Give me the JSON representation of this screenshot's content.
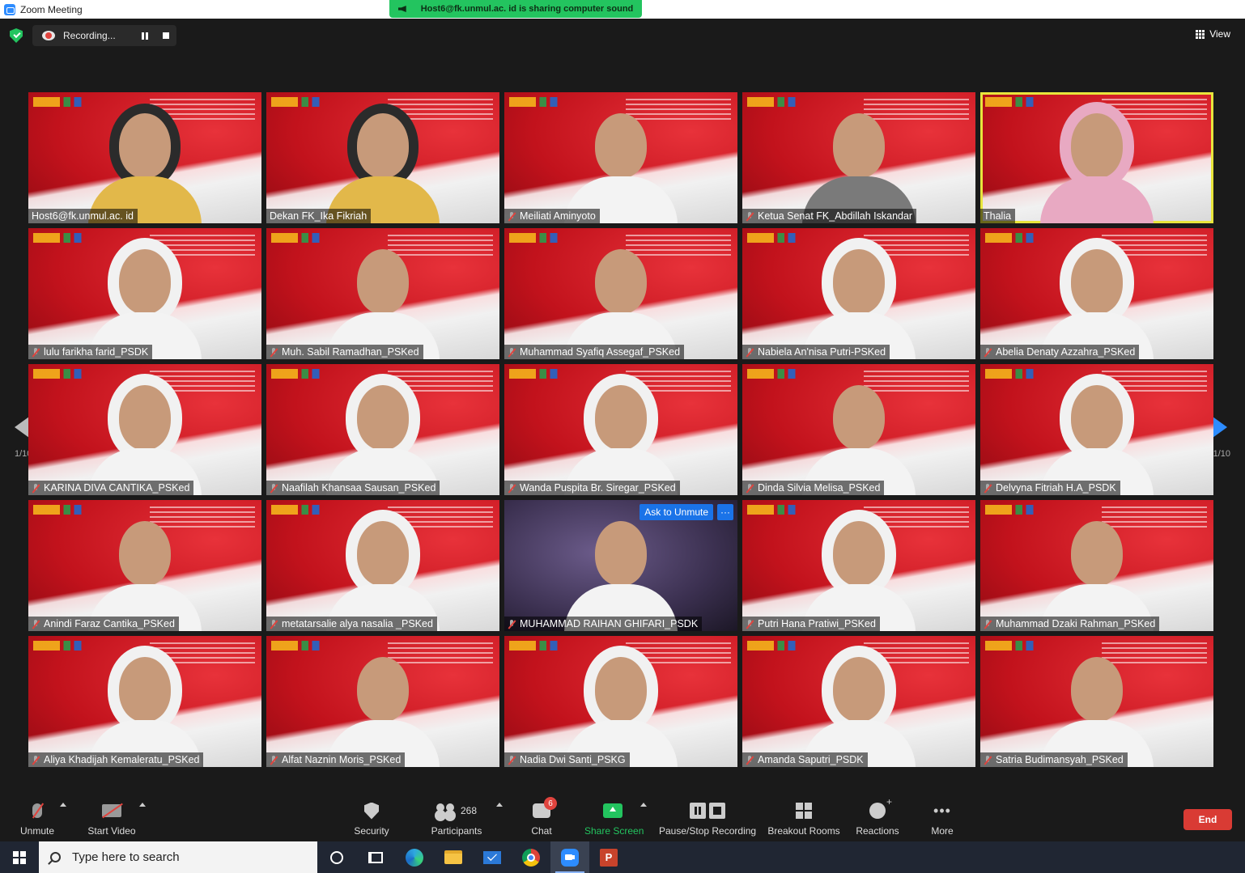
{
  "window": {
    "title": "Zoom Meeting"
  },
  "share_banner": {
    "text": "Host6@fk.unmul.ac. id is sharing computer sound"
  },
  "recording": {
    "label": "Recording..."
  },
  "view": {
    "label": "View"
  },
  "pager": {
    "left_label": "1/10",
    "right_label": "1/10"
  },
  "ask_to_unmute": "Ask to Unmute",
  "tile_more": "···",
  "participants": [
    {
      "name": "Host6@fk.unmul.ac. id",
      "muted": false,
      "active": true
    },
    {
      "name": "Dekan FK_Ika Fikriah",
      "muted": false
    },
    {
      "name": "Meiliati Aminyoto",
      "muted": true
    },
    {
      "name": "Ketua Senat FK_Abdillah Iskandar",
      "muted": true
    },
    {
      "name": "Thalia",
      "muted": false,
      "speaking": true
    },
    {
      "name": "lulu farikha farid_PSDK",
      "muted": true
    },
    {
      "name": "Muh. Sabil Ramadhan_PSKed",
      "muted": true
    },
    {
      "name": "Muhammad Syafiq Assegaf_PSKed",
      "muted": true
    },
    {
      "name": "Nabiela An'nisa Putri-PSKed",
      "muted": true
    },
    {
      "name": "Abelia Denaty Azzahra_PSKed",
      "muted": true
    },
    {
      "name": "KARINA DIVA CANTIKA_PSKed",
      "muted": true
    },
    {
      "name": "Naafilah Khansaa Sausan_PSKed",
      "muted": true
    },
    {
      "name": "Wanda Puspita Br. Siregar_PSKed",
      "muted": true
    },
    {
      "name": "Dinda Silvia Melisa_PSKed",
      "muted": true
    },
    {
      "name": "Delvyna Fitriah H.A_PSDK",
      "muted": true
    },
    {
      "name": "Anindi Faraz Cantika_PSKed",
      "muted": true
    },
    {
      "name": "metatarsalie alya nasalia _PSKed",
      "muted": true
    },
    {
      "name": "MUHAMMAD RAIHAN GHIFARI_PSDK",
      "muted": true
    },
    {
      "name": "Putri Hana Pratiwi_PSKed",
      "muted": true
    },
    {
      "name": "Muhammad Dzaki Rahman_PSKed",
      "muted": true
    },
    {
      "name": "Aliya Khadijah Kemaleratu_PSKed",
      "muted": true
    },
    {
      "name": "Alfat Naznin Moris_PSKed",
      "muted": true
    },
    {
      "name": "Nadia Dwi Santi_PSKG",
      "muted": true
    },
    {
      "name": "Amanda Saputri_PSDK",
      "muted": true
    },
    {
      "name": "Satria Budimansyah_PSKed",
      "muted": true
    }
  ],
  "toolbar": {
    "unmute": "Unmute",
    "start_video": "Start Video",
    "security": "Security",
    "participants": "Participants",
    "participants_count": "268",
    "chat": "Chat",
    "chat_badge": "6",
    "share_screen": "Share Screen",
    "pause_stop_recording": "Pause/Stop Recording",
    "breakout_rooms": "Breakout Rooms",
    "reactions": "Reactions",
    "more": "More",
    "end": "End"
  },
  "taskbar": {
    "search_placeholder": "Type here to search",
    "ppt_letter": "P"
  },
  "colors": {
    "accent_green": "#23c45f",
    "accent_blue": "#2d8cff",
    "end_red": "#d93b34",
    "speaker_outline": "#e8e53c"
  }
}
